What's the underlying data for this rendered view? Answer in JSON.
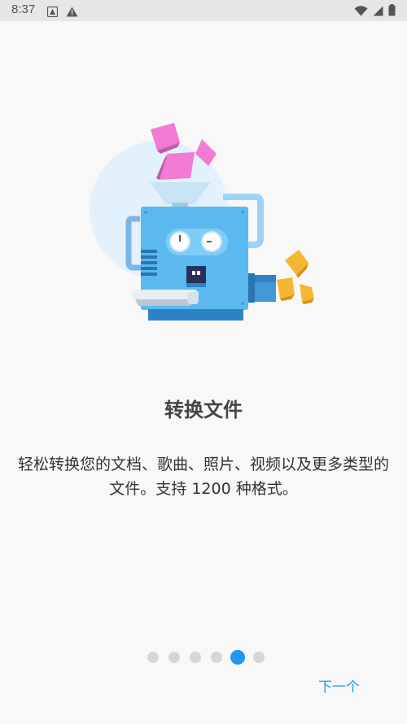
{
  "status_bar": {
    "time": "8:37",
    "left_icons": [
      "accessibility-icon",
      "warning-icon"
    ],
    "right_icons": [
      "wifi-icon",
      "signal-icon",
      "battery-icon"
    ]
  },
  "onboarding": {
    "title": "转换文件",
    "description": "轻松转换您的文档、歌曲、照片、视频以及更多类型的文件。支持 1200 种格式。",
    "page_count": 6,
    "active_page": 5,
    "next_label": "下一个"
  },
  "colors": {
    "accent": "#2196f3",
    "dot_inactive": "#d6d6d6",
    "machine_body": "#5bb9f0",
    "pink_cubes": "#f27bd4",
    "yellow_cubes": "#f5b731"
  }
}
